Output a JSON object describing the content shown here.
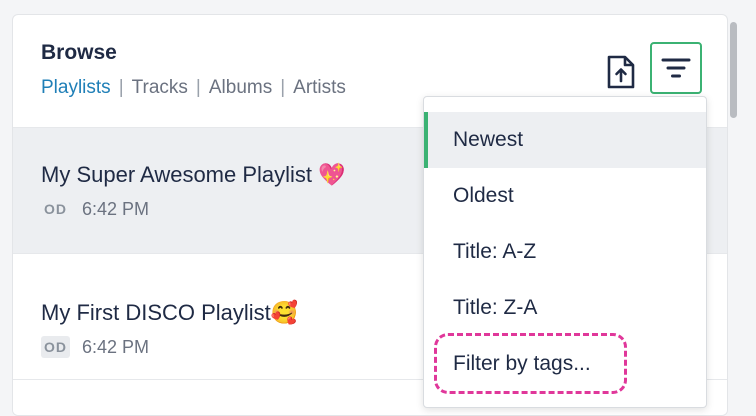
{
  "header": {
    "title": "Browse",
    "tabs": [
      {
        "label": "Playlists",
        "active": true
      },
      {
        "label": "Tracks",
        "active": false
      },
      {
        "label": "Albums",
        "active": false
      },
      {
        "label": "Artists",
        "active": false
      }
    ],
    "tab_separator": "|"
  },
  "playlists": [
    {
      "name": "My Super Awesome Playlist 💖",
      "badge": "OD",
      "time": "6:42 PM"
    },
    {
      "name": "My First DISCO Playlist🥰",
      "badge": "OD",
      "time": "6:42 PM"
    }
  ],
  "sort_menu": {
    "items": [
      {
        "label": "Newest",
        "selected": true
      },
      {
        "label": "Oldest",
        "selected": false
      },
      {
        "label": "Title: A-Z",
        "selected": false
      },
      {
        "label": "Title: Z-A",
        "selected": false
      },
      {
        "label": "Filter by tags...",
        "selected": false,
        "highlighted": true
      }
    ]
  },
  "icons": {
    "export": "file-upload-icon",
    "sort": "sort-filter-icon"
  },
  "colors": {
    "accent_green": "#3bb273",
    "active_tab": "#1f7fb7",
    "highlight_pink": "#e0379a",
    "text_dark": "#1f2a44"
  }
}
